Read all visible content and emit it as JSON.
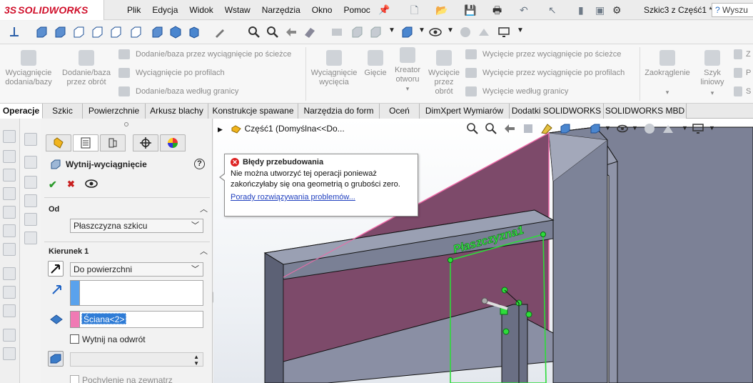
{
  "app": {
    "logo_ds": "3S",
    "logo_text": "SOLIDWORKS",
    "menu": [
      "Plik",
      "Edycja",
      "Widok",
      "Wstaw",
      "Narzędzia",
      "Okno",
      "Pomoc"
    ],
    "document_title": "Szkic3 z Część1 *",
    "search_placeholder": "Wyszu"
  },
  "command_manager": {
    "extrude_boss": "Wyciągnięcie dodania/bazy",
    "revolve_boss": "Dodanie/baza przez obrót",
    "swept_boss": "Dodanie/baza przez wyciągnięcie po ścieżce",
    "lofted_boss": "Wyciągnięcie po profilach",
    "boundary_boss": "Dodanie/baza według granicy",
    "extruded_cut": "Wyciągnięcie wycięcia",
    "hole": "Gięcie",
    "hole_wizard": "Kreator otworu",
    "revolved_cut": "Wycięcie przez obrót",
    "swept_cut": "Wycięcie przez wyciągnięcie po ścieżce",
    "lofted_cut": "Wycięcie przez wyciągnięcie po profilach",
    "boundary_cut": "Wycięcie według granicy",
    "fillet": "Zaokrąglenie",
    "linear_pattern": "Szyk liniowy",
    "right_col": [
      "Z",
      "P",
      "S"
    ]
  },
  "tabs": [
    "Operacje",
    "Szkic",
    "Powierzchnie",
    "Arkusz blachy",
    "Konstrukcje spawane",
    "Narzędzia do form",
    "Oceń",
    "DimXpert Wymiarów",
    "Dodatki SOLIDWORKS",
    "SOLIDWORKS MBD"
  ],
  "property_manager": {
    "title": "Wytnij-wyciągnięcie",
    "help": "?",
    "ok": "✔",
    "cancel": "✖",
    "from_header": "Od",
    "from_value": "Płaszczyzna szkicu",
    "dir1_header": "Kierunek 1",
    "dir1_end": "Do powierzchni",
    "face_ref": "Ściana<2>",
    "flip_side": "Wytnij na odwrót",
    "draft_outward": "Pochylenie na zewnatrz"
  },
  "viewport": {
    "tree_label": "Część1  (Domyślna<<Do...",
    "plane_label": "Płaszczyzna1"
  },
  "error_tip": {
    "title": "Błędy przebudowania",
    "body": "Nie można utworzyć tej operacji ponieważ zakończyłaby się ona geometrią o grubości zero.",
    "link": "Porady rozwiązywania problemów..."
  },
  "colors": {
    "brand_red": "#d0102b",
    "selection_blue": "#2f7cd6",
    "face_pink": "#e8609e",
    "plane_green": "#2ddc3a"
  }
}
